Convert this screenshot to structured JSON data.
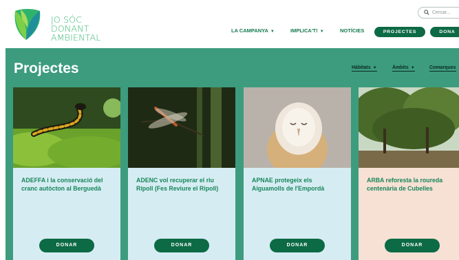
{
  "brand": {
    "line1": "JO SÓC",
    "line2": "DONANT",
    "line3": "AMBIENTAL",
    "colors": {
      "green": "#34b46e",
      "dark_green": "#0c6a45",
      "teal": "#3d9c7e"
    }
  },
  "search": {
    "placeholder": "Cercar..."
  },
  "nav": {
    "items": [
      {
        "label": "LA CAMPANYA",
        "has_dropdown": true
      },
      {
        "label": "IMPLICA'T!",
        "has_dropdown": true
      },
      {
        "label": "NOTÍCIES",
        "has_dropdown": false
      }
    ],
    "buttons": {
      "projectes": "PROJECTES",
      "dona": "DONA"
    }
  },
  "page": {
    "title": "Projectes",
    "filters": [
      "Hàbitats",
      "Àmbits",
      "Comarques"
    ]
  },
  "cards": [
    {
      "title": "ADEFFA i la conservació del cranc autòcton al Berguedà",
      "button": "DONAR",
      "image": "salamander-on-moss"
    },
    {
      "title": "ADENC vol recuperar el riu Ripoll (Fes Reviure el Ripoll)",
      "button": "DONAR",
      "image": "dragonfly-on-reed"
    },
    {
      "title": "APNAE protegeix els Aiguamolls de l'Empordà",
      "button": "DONAR",
      "image": "barn-owl"
    },
    {
      "title": "ARBA reforesta la roureda centenària de Cubelles",
      "button": "DONAR",
      "image": "oak-forest"
    }
  ]
}
